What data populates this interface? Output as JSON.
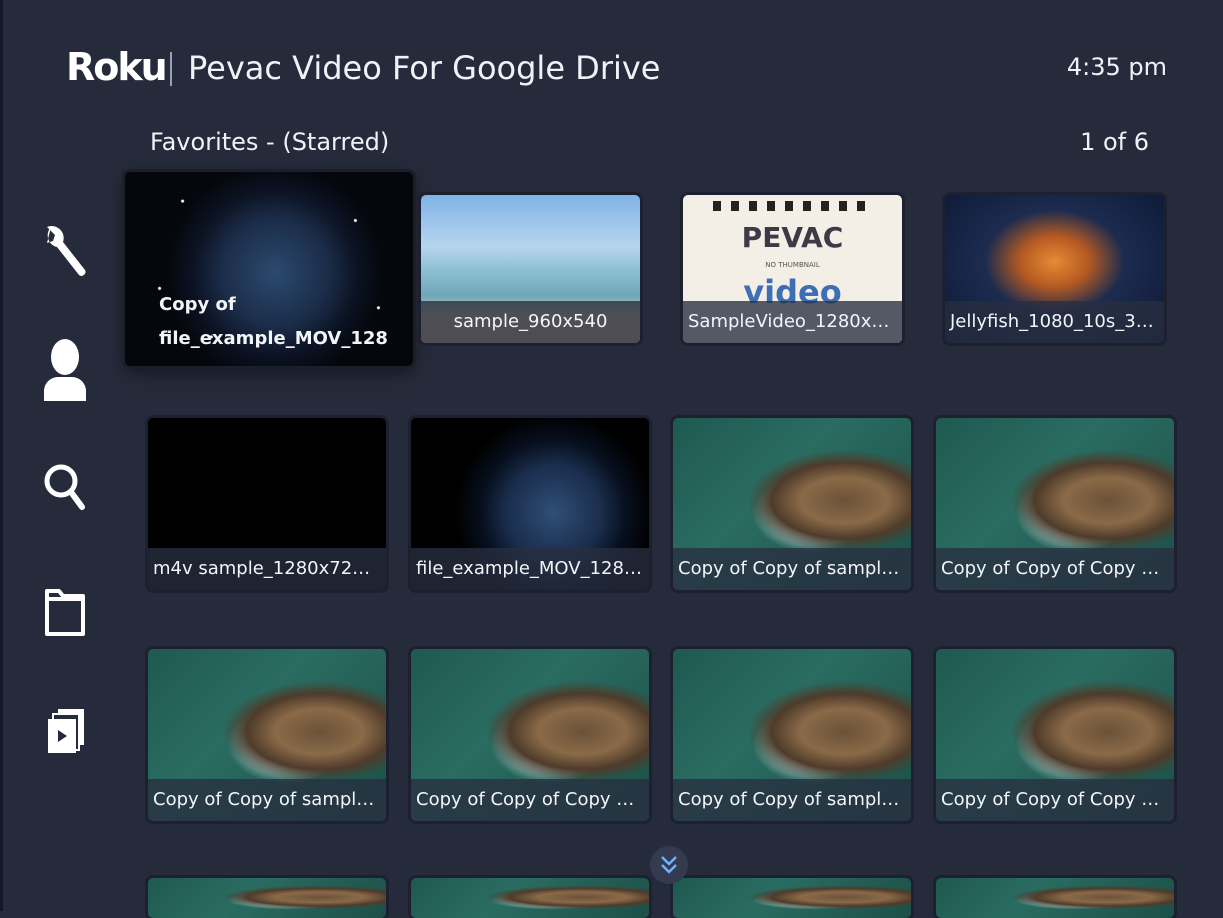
{
  "header": {
    "logo_text": "Roku",
    "app_title": "Pevac Video For Google Drive",
    "clock": "4:35 pm"
  },
  "section": {
    "title": "Favorites - (Starred)",
    "pager": "1 of 6"
  },
  "sidebar": {
    "items": [
      {
        "icon": "wrench-icon"
      },
      {
        "icon": "user-icon"
      },
      {
        "icon": "search-icon"
      },
      {
        "icon": "folder-icon"
      },
      {
        "icon": "playlist-icon"
      }
    ]
  },
  "grid": {
    "row1": [
      {
        "caption_line1": "Copy of",
        "caption_line2": "file_example_MOV_128",
        "thumb": "space"
      },
      {
        "caption": "sample_960x540",
        "thumb": "beach"
      },
      {
        "caption": "SampleVideo_1280x72...",
        "thumb": "pevac"
      },
      {
        "caption": "Jellyfish_1080_10s_30...",
        "thumb": "jellyfish"
      }
    ],
    "row2": [
      {
        "caption": "m4v sample_1280x720_s...",
        "thumb": "black"
      },
      {
        "caption": "file_example_MOV_1280...",
        "thumb": "earth"
      },
      {
        "caption": "Copy of Copy of sample_...",
        "thumb": "coast"
      },
      {
        "caption": "Copy of Copy of Copy of ...",
        "thumb": "coast"
      }
    ],
    "row3": [
      {
        "caption": "Copy of Copy of sample_...",
        "thumb": "coast"
      },
      {
        "caption": "Copy of Copy of Copy of ...",
        "thumb": "coast"
      },
      {
        "caption": "Copy of Copy of sample_...",
        "thumb": "coast"
      },
      {
        "caption": "Copy of Copy of Copy of ...",
        "thumb": "coast"
      }
    ]
  },
  "pevac_thumb": {
    "brand": "PEVAC",
    "note": "NO THUMBNAIL",
    "word": "video"
  }
}
